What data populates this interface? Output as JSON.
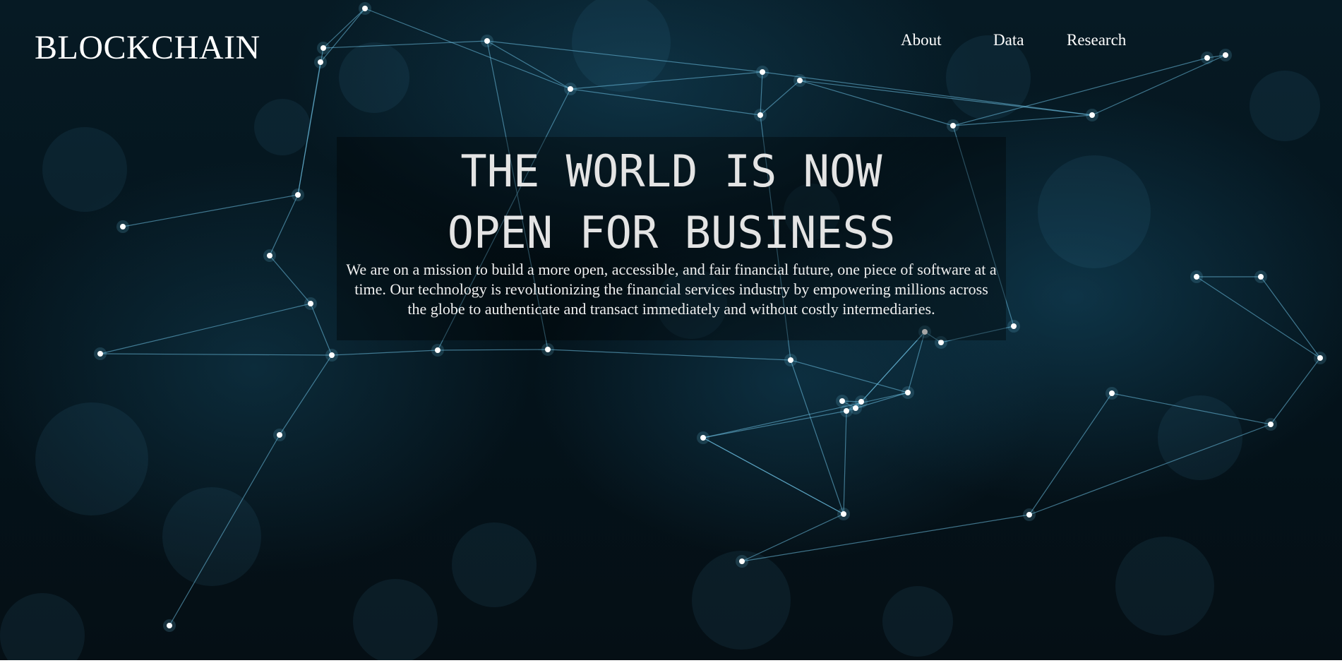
{
  "header": {
    "brand": "BLOCKCHAIN",
    "nav": [
      {
        "label": "About"
      },
      {
        "label": "Data"
      },
      {
        "label": "Research"
      }
    ]
  },
  "hero": {
    "headline_line1": "THE WORLD IS NOW",
    "headline_line2": "OPEN FOR BUSINESS",
    "mission": "We are on a mission to build a more open, accessible, and fair financial future, one piece of software at a time. Our technology is revolutionizing the financial services industry by empowering millions across the globe to authenticate and transact immediately and without costly intermediaries."
  },
  "colors": {
    "background": "#061a24",
    "network_line": "#6fc3e6",
    "node": "#ffffff",
    "text": "#ffffff"
  }
}
